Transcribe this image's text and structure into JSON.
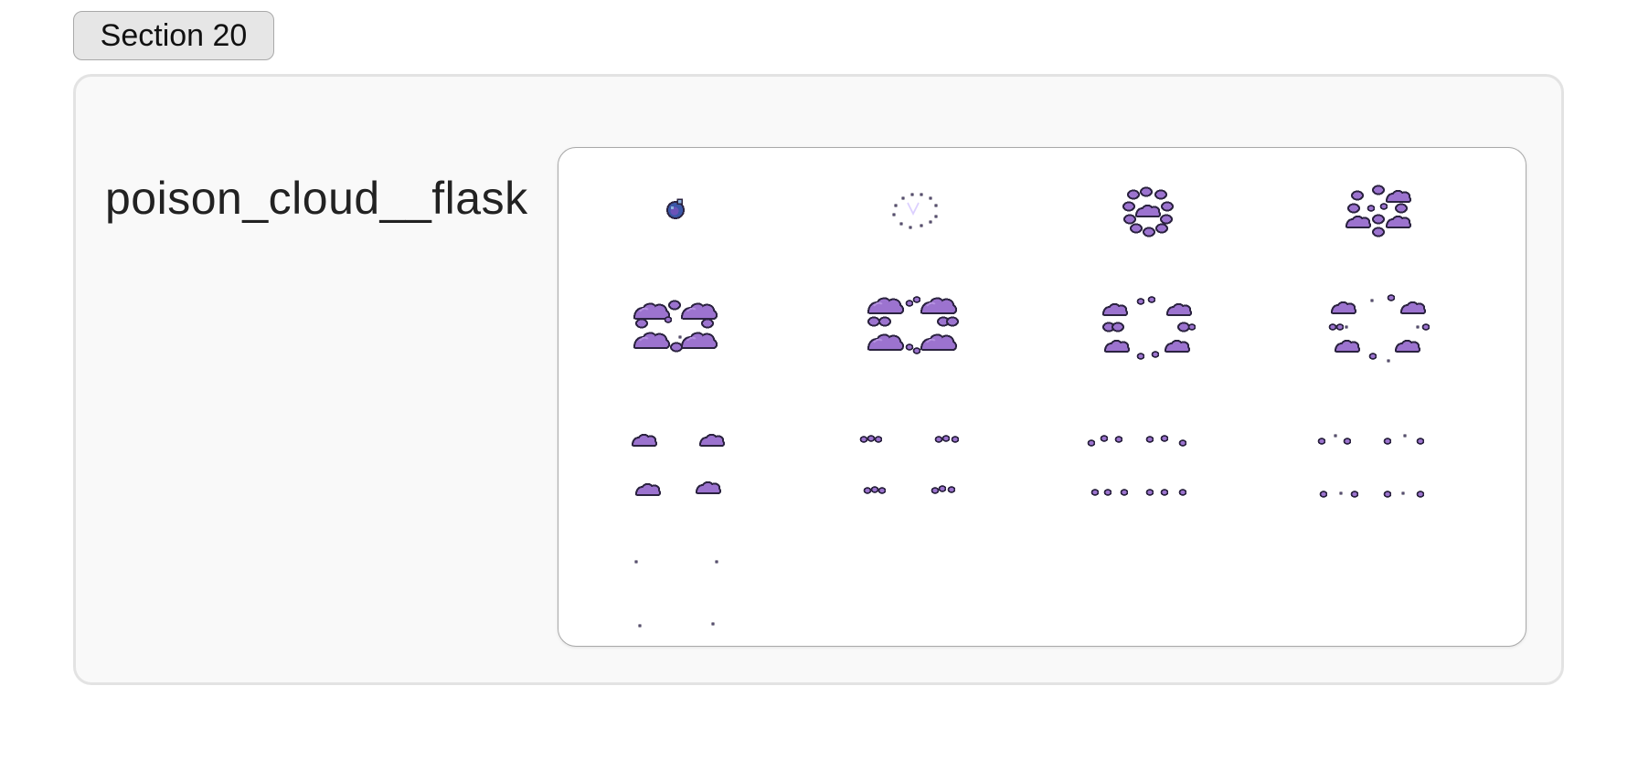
{
  "section": {
    "label": "Section 20"
  },
  "sprite": {
    "name": "poison_cloud__flask",
    "frame_count": 14,
    "columns": 4,
    "colors": {
      "cloud_fill": "#9c73cf",
      "cloud_highlight": "#b591e0",
      "outline": "#2b2340",
      "flask_fill": "#3b57a8",
      "flask_glass": "#8cb2e0",
      "sparkle": "#dcd0ff"
    }
  }
}
